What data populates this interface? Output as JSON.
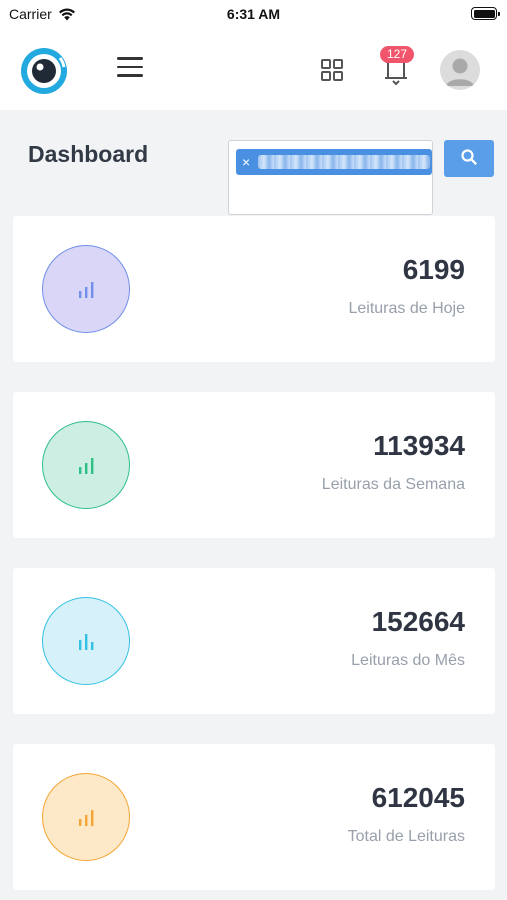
{
  "status_bar": {
    "carrier": "Carrier",
    "time": "6:31 AM"
  },
  "header": {
    "notification_count": "127"
  },
  "page": {
    "title": "Dashboard"
  },
  "search": {
    "chip_remove": "×"
  },
  "colors": {
    "purple": "#6f8fe8",
    "purple_bg": "#d9d6f7",
    "green": "#2ebf86",
    "green_bg": "#cdeee3",
    "cyan": "#34c1e3",
    "cyan_bg": "#d6f1f9",
    "orange": "#f4a536",
    "orange_bg": "#fde8c7"
  },
  "cards": [
    {
      "value": "6199",
      "label": "Leituras de Hoje",
      "icon": "bar-chart-icon"
    },
    {
      "value": "113934",
      "label": "Leituras da Semana",
      "icon": "bar-chart-icon"
    },
    {
      "value": "152664",
      "label": "Leituras do Mês",
      "icon": "bar-chart-icon"
    },
    {
      "value": "612045",
      "label": "Total de Leituras",
      "icon": "bar-chart-icon"
    }
  ]
}
